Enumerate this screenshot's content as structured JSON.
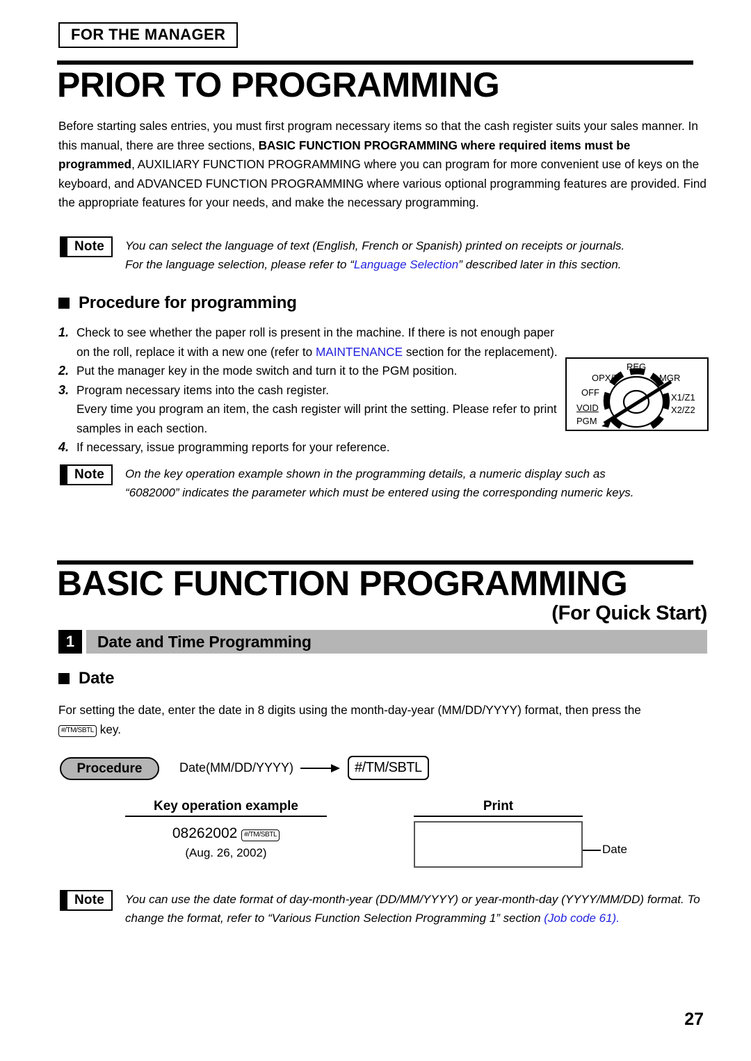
{
  "header": {
    "manager_tag": "FOR THE MANAGER"
  },
  "chapter1": {
    "title": "PRIOR TO PROGRAMMING",
    "intro_p1": "Before starting sales entries, you must first program necessary items so that the cash register suits your sales manner.  In this manual, there are three sections, ",
    "intro_bold": "BASIC FUNCTION PROGRAMMING where required items must be programmed",
    "intro_p2": ", AUXILIARY FUNCTION PROGRAMMING where you can program for more convenient use of keys on the keyboard, and ADVANCED FUNCTION PROGRAMMING where various optional programming features are provided.  Find the appropriate features for your needs, and make the necessary programming."
  },
  "note1": {
    "label": "Note",
    "line1": "You can select the language of text (English, French or Spanish) printed on receipts or journals.",
    "line2_pre": "For the language selection, please refer to “",
    "line2_link": "Language Selection",
    "line2_post": "” described later in this section."
  },
  "procedure_section": {
    "heading": "Procedure for programming",
    "items": [
      {
        "num": "1.",
        "text_pre": "Check to see whether the paper roll is present in the machine.  If there is not enough paper on the roll, replace it with a new one (refer to ",
        "link": "MAINTENANCE",
        "text_post": " section for the replacement)."
      },
      {
        "num": "2.",
        "text_pre": "Put the manager key in the mode switch and turn it to the PGM position.",
        "link": "",
        "text_post": ""
      },
      {
        "num": "3.",
        "text_pre": "Program necessary items into the cash register.",
        "link": "",
        "text_post": ""
      },
      {
        "num": "4.",
        "text_pre": "If necessary, issue programming reports for your reference.",
        "link": "",
        "text_post": ""
      }
    ],
    "item3_continuation": "Every time you program an item, the cash register will print the setting.  Please refer to print samples in each section."
  },
  "mode_switch": {
    "positions": [
      "REG",
      "OPX/Z",
      "MGR",
      "OFF",
      "X1/Z1",
      "VOID",
      "X2/Z2",
      "PGM"
    ],
    "labels": {
      "reg": "REG",
      "opxz": "OPX/Z",
      "mgr": "MGR",
      "off": "OFF",
      "x1z1": "X1/Z1",
      "void": "VOID",
      "x2z2": "X2/Z2",
      "pgm": "PGM"
    }
  },
  "note2": {
    "label": "Note",
    "line1": "On the key operation example shown in the programming details, a numeric display such as",
    "line2": "“6082000” indicates the parameter which must be entered using the corresponding numeric keys."
  },
  "chapter2": {
    "title": "BASIC FUNCTION PROGRAMMING",
    "subtitle": "(For Quick Start)"
  },
  "section1": {
    "number": "1",
    "title": "Date and Time Programming",
    "sub_heading": "Date",
    "intro_pre": "For setting the date, enter the date in 8 digits using the month-day-year (MM/DD/YYYY) format, then press the ",
    "key_label": "#/TM/SBTL",
    "intro_post": " key."
  },
  "procedure_flow": {
    "pill_label": "Procedure",
    "input_label": "Date(MM/DD/YYYY)",
    "key_label": "#/TM/SBTL"
  },
  "example": {
    "key_operation_header": "Key operation example",
    "print_header": "Print",
    "entry_digits": "08262002",
    "entry_key": "#/TM/SBTL",
    "entry_note": "(Aug. 26, 2002)",
    "print_callout": "Date"
  },
  "note3": {
    "label": "Note",
    "line1": "You can use the date format of day-month-year (DD/MM/YYYY) or year-month-day (YYYY/MM/DD)",
    "line2_pre": "format.  To change the format, refer to “Various Function Selection Programming 1” section ",
    "line2_link": "(Job code 61).",
    "line2_post": ""
  },
  "footer": {
    "page_number": "27"
  },
  "colors": {
    "link_blue": "#2222dd",
    "bar_gray": "#b5b5b5",
    "black": "#000000"
  }
}
